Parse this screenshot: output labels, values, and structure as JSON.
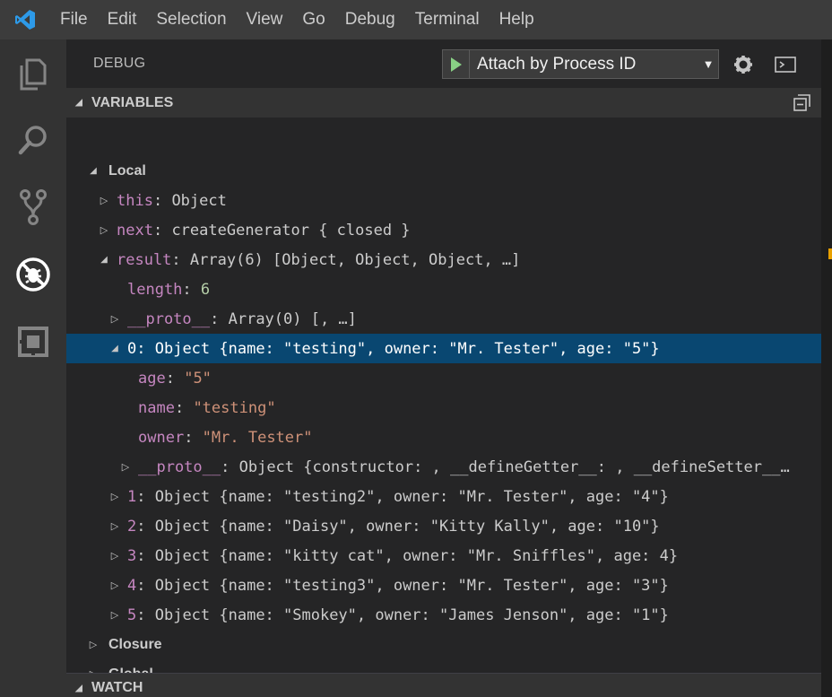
{
  "menu": [
    "File",
    "Edit",
    "Selection",
    "View",
    "Go",
    "Debug",
    "Terminal",
    "Help"
  ],
  "debug": {
    "title": "DEBUG",
    "config": "Attach by Process ID"
  },
  "sections": {
    "variables": "VARIABLES",
    "watch": "WATCH"
  },
  "tree": [
    {
      "indent": 0,
      "type": "scope",
      "state": "open",
      "label": "Local"
    },
    {
      "indent": 1,
      "state": "closed",
      "key": "this",
      "sep": ": ",
      "value": "Object",
      "vclass": "v"
    },
    {
      "indent": 1,
      "state": "closed",
      "key": "next",
      "sep": ": ",
      "value": "createGenerator { closed }",
      "vclass": "v"
    },
    {
      "indent": 1,
      "state": "open",
      "key": "result",
      "sep": ": ",
      "value": "Array(6) [Object, Object, Object, …]",
      "vclass": "v"
    },
    {
      "indent": 2,
      "state": "none",
      "key": "length",
      "sep": ": ",
      "value": "6",
      "vclass": "n"
    },
    {
      "indent": 2,
      "state": "closed",
      "key": "__proto__",
      "sep": ": ",
      "value": "Array(0) [, …]",
      "vclass": "v"
    },
    {
      "indent": 2,
      "state": "open",
      "selected": true,
      "key": "0",
      "sep": ": ",
      "value": "Object {name: \"testing\", owner: \"Mr. Tester\", age: \"5\"}",
      "vclass": "v"
    },
    {
      "indent": 3,
      "state": "none",
      "key": "age",
      "sep": ": ",
      "value": "\"5\"",
      "vclass": "s"
    },
    {
      "indent": 3,
      "state": "none",
      "key": "name",
      "sep": ": ",
      "value": "\"testing\"",
      "vclass": "s"
    },
    {
      "indent": 3,
      "state": "none",
      "key": "owner",
      "sep": ": ",
      "value": "\"Mr. Tester\"",
      "vclass": "s"
    },
    {
      "indent": 3,
      "state": "closed",
      "key": "__proto__",
      "sep": ": ",
      "value": "Object {constructor: , __defineGetter__: , __defineSetter__…",
      "vclass": "v"
    },
    {
      "indent": 2,
      "state": "closed",
      "key": "1",
      "sep": ": ",
      "value": "Object {name: \"testing2\", owner: \"Mr. Tester\", age: \"4\"}",
      "vclass": "v"
    },
    {
      "indent": 2,
      "state": "closed",
      "key": "2",
      "sep": ": ",
      "value": "Object {name: \"Daisy\", owner: \"Kitty Kally\", age: \"10\"}",
      "vclass": "v"
    },
    {
      "indent": 2,
      "state": "closed",
      "key": "3",
      "sep": ": ",
      "value": "Object {name: \"kitty cat\", owner: \"Mr. Sniffles\", age: 4}",
      "vclass": "v"
    },
    {
      "indent": 2,
      "state": "closed",
      "key": "4",
      "sep": ": ",
      "value": "Object {name: \"testing3\", owner: \"Mr. Tester\", age: \"3\"}",
      "vclass": "v"
    },
    {
      "indent": 2,
      "state": "closed",
      "key": "5",
      "sep": ": ",
      "value": "Object {name: \"Smokey\", owner: \"James Jenson\", age: \"1\"}",
      "vclass": "v"
    },
    {
      "indent": 0,
      "type": "scope",
      "state": "closed",
      "label": "Closure"
    },
    {
      "indent": 0,
      "type": "scope",
      "state": "closed",
      "label": "Global"
    }
  ],
  "colors": {
    "selection": "#094771",
    "key": "#c586c0",
    "string": "#ce9178",
    "number": "#b5cea8",
    "play": "#89d185"
  }
}
